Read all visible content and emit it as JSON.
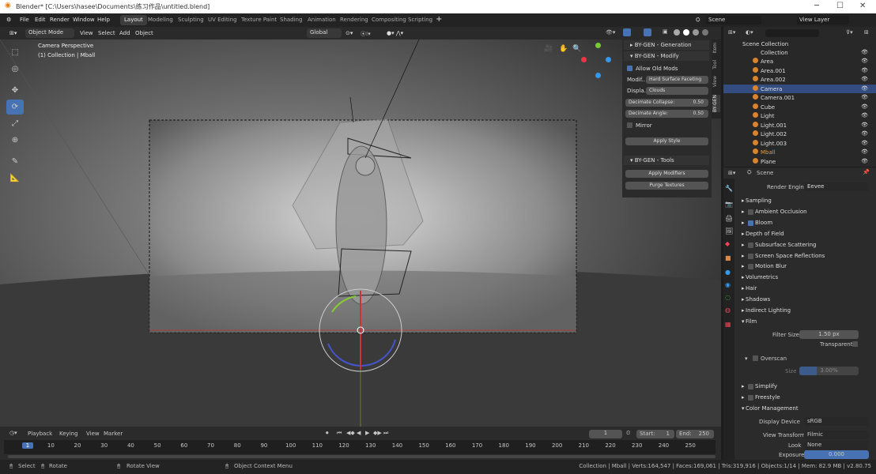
{
  "title": "Blender* [C:\\Users\\hasee\\Documents\\练习作品\\untitled.blend]",
  "menus": [
    "File",
    "Edit",
    "Render",
    "Window",
    "Help"
  ],
  "workspaces": [
    "Layout",
    "Modeling",
    "Sculpting",
    "UV Editing",
    "Texture Paint",
    "Shading",
    "Animation",
    "Rendering",
    "Compositing",
    "Scripting"
  ],
  "scene": "Scene",
  "view_layer": "View Layer",
  "header": {
    "mode": "Object Mode",
    "view": "View",
    "select": "Select",
    "add": "Add",
    "object": "Object",
    "orientation": "Global"
  },
  "viewport": {
    "camera": "Camera Perspective",
    "collection": "(1) Collection | Mball"
  },
  "npanel": {
    "tabs": [
      "Item",
      "Tool",
      "View",
      "BY-GEN"
    ],
    "generation": "BY-GEN - Generation",
    "modify": "BY-GEN - Modify",
    "allow_old_mods": "Allow Old Mods",
    "modif_label": "Modif..",
    "modif_value": "Hard Surface Faceting",
    "displa_label": "Displa..",
    "displa_value": "Clouds",
    "decimate_collapse_label": "Decimate Collapse:",
    "decimate_collapse": "0.50",
    "decimate_angle_label": "Decimate Angle:",
    "decimate_angle": "0.50",
    "mirror": "Mirror",
    "apply_style": "Apply Style",
    "tools": "BY-GEN - Tools",
    "apply_modifiers": "Apply Modifiers",
    "purge_textures": "Purge Textures"
  },
  "outliner": {
    "root": "Scene Collection",
    "collection": "Collection",
    "items": [
      "Area",
      "Area.001",
      "Area.002",
      "Camera",
      "Camera.001",
      "Cube",
      "Light",
      "Light.001",
      "Light.002",
      "Light.003",
      "Mball",
      "Plane"
    ],
    "selected": "Camera"
  },
  "properties": {
    "scene": "Scene",
    "render_engine_label": "Render Engine",
    "render_engine": "Eevee",
    "sections": [
      "Sampling",
      "Ambient Occlusion",
      "Bloom",
      "Depth of Field",
      "Subsurface Scattering",
      "Screen Space Reflections",
      "Motion Blur",
      "Volumetrics",
      "Hair",
      "Shadows",
      "Indirect Lighting",
      "Film"
    ],
    "filter_size_label": "Filter Size",
    "filter_size": "1.50 px",
    "transparent": "Transparent",
    "overscan": "Overscan",
    "size_label": "Size",
    "size_value": "3.00%",
    "simplify": "Simplify",
    "freestyle": "Freestyle",
    "color_management": "Color Management",
    "display_device_label": "Display Device",
    "display_device": "sRGB",
    "view_transform_label": "View Transform",
    "view_transform": "Filmic",
    "look_label": "Look",
    "look": "None",
    "exposure_label": "Exposure",
    "exposure": "0.000"
  },
  "timeline": {
    "playback": "Playback",
    "keying": "Keying",
    "view": "View",
    "marker": "Marker",
    "current_frame": "1",
    "start_label": "Start:",
    "start": "1",
    "end_label": "End:",
    "end": "250",
    "ticks": [
      "1",
      "10",
      "20",
      "30",
      "40",
      "50",
      "60",
      "70",
      "80",
      "90",
      "100",
      "110",
      "120",
      "130",
      "140",
      "150",
      "160",
      "170",
      "180",
      "190",
      "200",
      "210",
      "220",
      "230",
      "240",
      "250"
    ]
  },
  "status": {
    "select": "Select",
    "rotate": "Rotate",
    "rotate_view": "Rotate View",
    "context": "Object Context Menu",
    "stats": "Collection | Mball | Verts:164,547 | Faces:169,061 | Tris:319,916 | Objects:1/14 | Mem: 82.9 MB | v2.80.75"
  },
  "colors": {
    "accent": "#4772b3",
    "selected_row": "#334d80",
    "object_orange": "#d8842f"
  }
}
